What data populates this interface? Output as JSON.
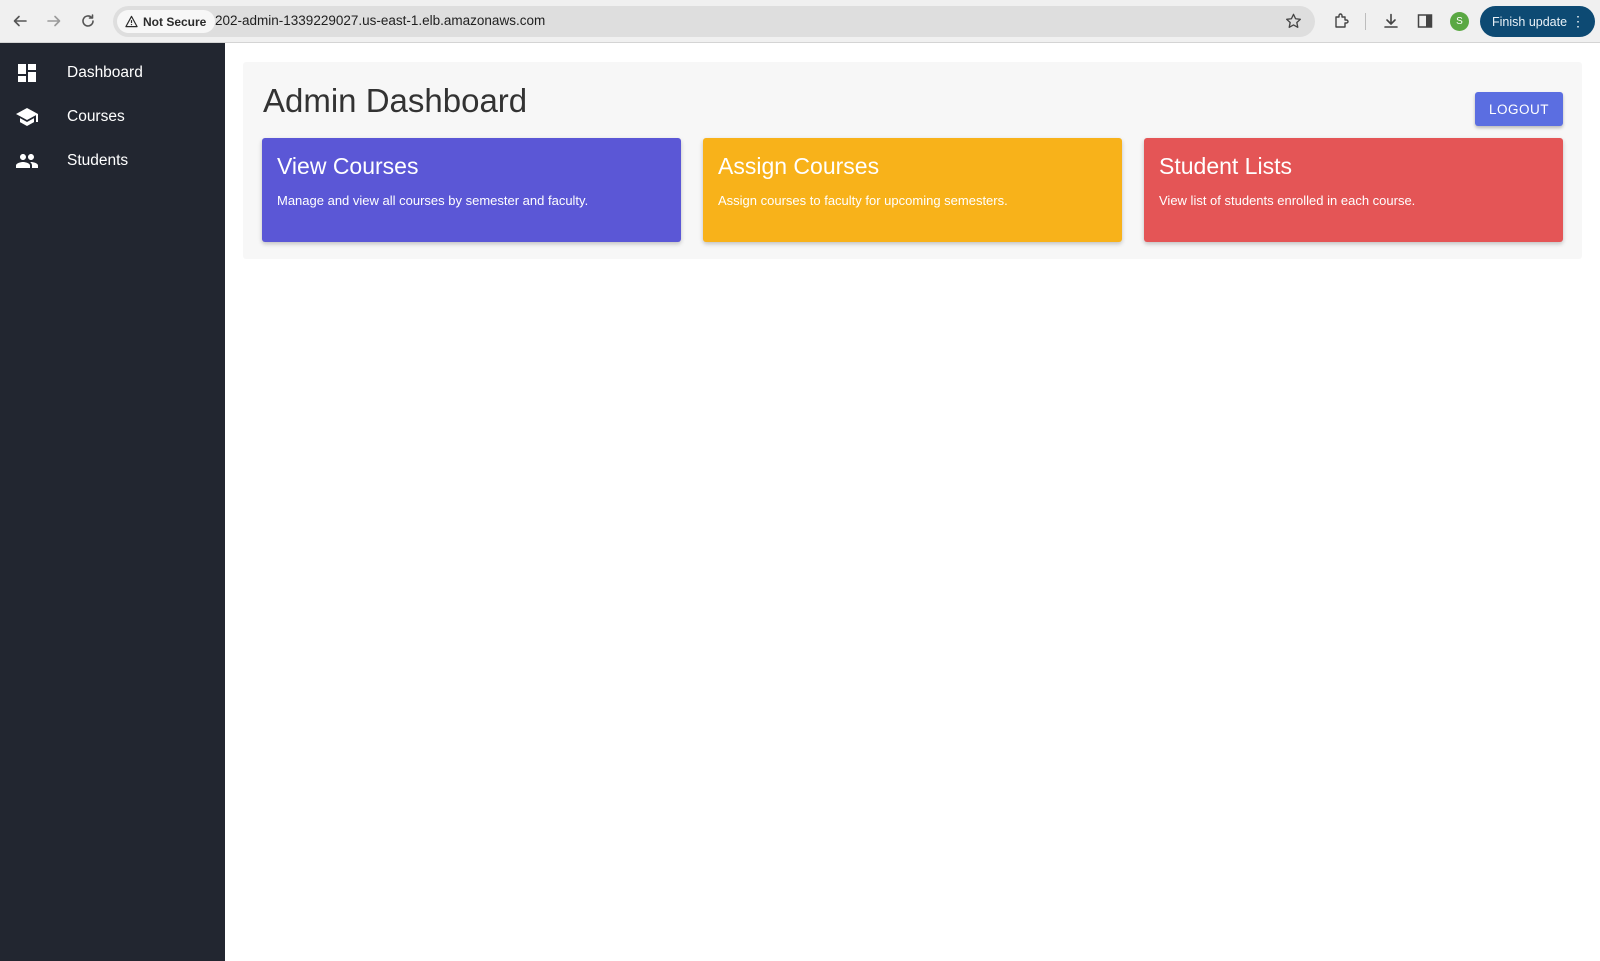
{
  "browser": {
    "security_label": "Not Secure",
    "url": "202-admin-1339229027.us-east-1.elb.amazonaws.com",
    "profile_initial": "S",
    "update_label": "Finish update"
  },
  "sidebar": {
    "items": [
      {
        "label": "Dashboard",
        "icon": "dashboard-icon"
      },
      {
        "label": "Courses",
        "icon": "school-icon"
      },
      {
        "label": "Students",
        "icon": "people-icon"
      }
    ]
  },
  "main": {
    "title": "Admin Dashboard",
    "logout_label": "LOGOUT",
    "cards": [
      {
        "title": "View Courses",
        "description": "Manage and view all courses by semester and faculty.",
        "color": "#5b57d6"
      },
      {
        "title": "Assign Courses",
        "description": "Assign courses to faculty for upcoming semesters.",
        "color": "#f8b21a"
      },
      {
        "title": "Student Lists",
        "description": "View list of students enrolled in each course.",
        "color": "#e45556"
      }
    ]
  },
  "colors": {
    "sidebar_bg": "#222630",
    "logout_button": "#5b6ee1",
    "update_button": "#0d4a73"
  }
}
